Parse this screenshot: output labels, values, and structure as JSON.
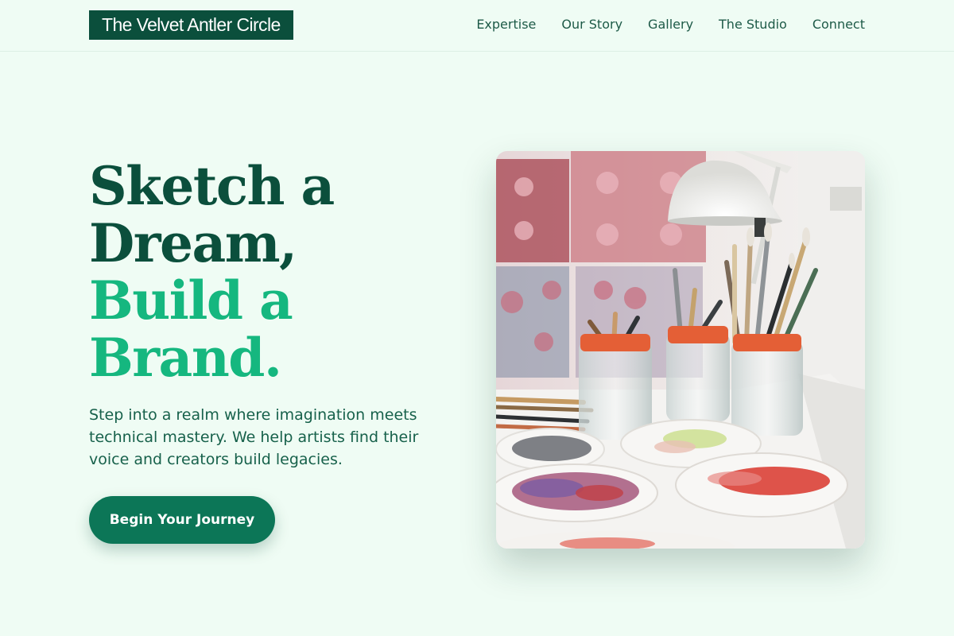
{
  "header": {
    "logo_text": "The Velvet Antler Circle",
    "nav": [
      {
        "label": "Expertise"
      },
      {
        "label": "Our Story"
      },
      {
        "label": "Gallery"
      },
      {
        "label": "The Studio"
      },
      {
        "label": "Connect"
      }
    ]
  },
  "hero": {
    "headline_lines": [
      "Sketch a",
      "Dream,",
      "Build a",
      "Brand."
    ],
    "subtext": "Step into a realm where imagination meets technical mastery. We help artists find their voice and creators build legacies.",
    "cta_label": "Begin Your Journey",
    "image_icon": "art-studio-photo"
  },
  "colors": {
    "background": "#effcf4",
    "brand_dark": "#0b4f3c",
    "accent": "#15b77f",
    "button": "#0c7657"
  }
}
